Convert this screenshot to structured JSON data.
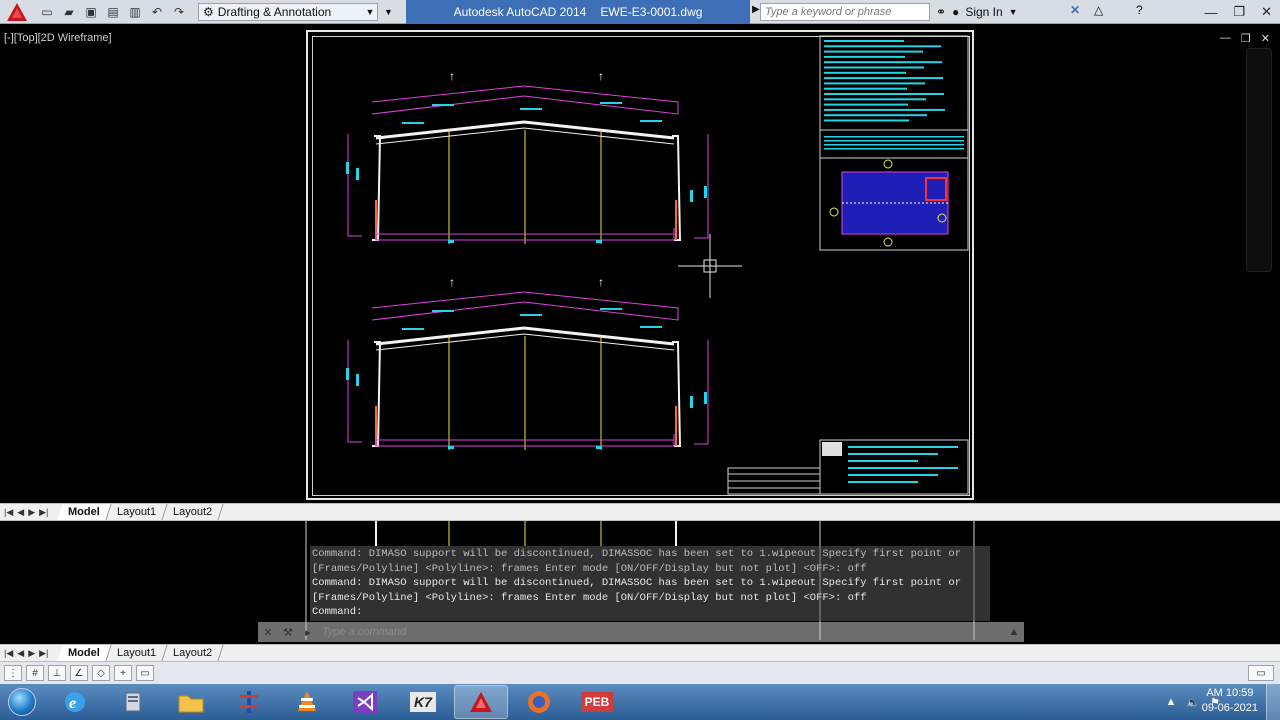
{
  "titlebar": {
    "workspace": "Drafting & Annotation",
    "app_title": "Autodesk AutoCAD 2014",
    "file_name": "EWE-E3-0001.dwg",
    "search_placeholder": "Type a keyword or phrase",
    "signin_label": "Sign In"
  },
  "viewport": {
    "label": "[-][Top][2D Wireframe]"
  },
  "layout_tabs": [
    "Model",
    "Layout1",
    "Layout2"
  ],
  "command_line": {
    "history": [
      "Command: DIMASO support will be discontinued, DIMASSOC has been set to 1.wipeout Specify first point or",
      "[Frames/Polyline] <Polyline>: frames Enter mode [ON/OFF/Display but not plot] <OFF>: off",
      "Command: DIMASO support will be discontinued, DIMASSOC has been set to 1.wipeout Specify first point or",
      "[Frames/Polyline] <Polyline>: frames Enter mode [ON/OFF/Display but not plot] <OFF>: off",
      "Command:"
    ],
    "input_placeholder": "Type a command"
  },
  "taskbar": {
    "apps": [
      "start",
      "ie",
      "explorer",
      "folder",
      "staad",
      "vlc",
      "visual-studio",
      "k7",
      "autocad",
      "firefox",
      "peb"
    ],
    "peb_label": "PEB",
    "k7_label": "K7",
    "clock_time": "AM 10:59",
    "clock_date": "09-06-2021"
  },
  "colors": {
    "magenta": "#e040e0",
    "cyan": "#23d3e6",
    "yellow": "#e6e640",
    "orange": "#ff6a2a",
    "blue_fill": "#1f1fb8",
    "title_accent": "#3e6fb6"
  }
}
